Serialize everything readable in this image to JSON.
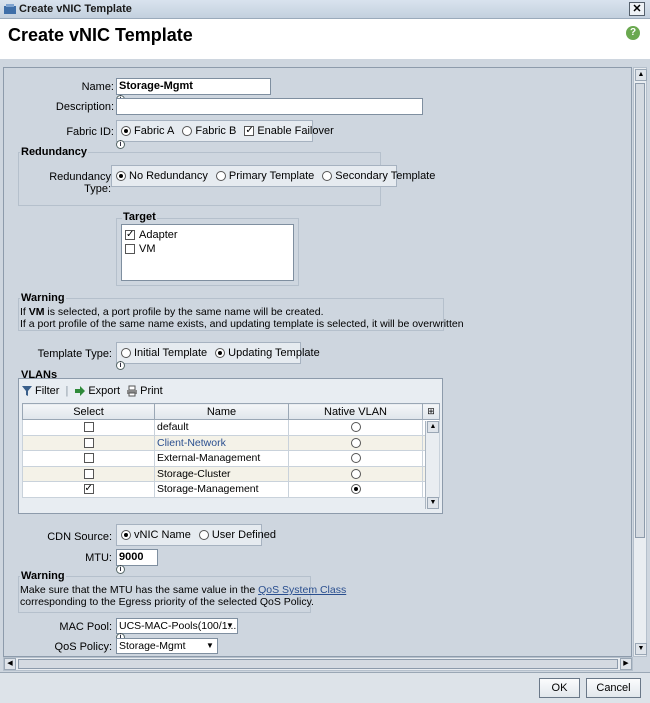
{
  "window": {
    "title": "Create vNIC Template",
    "close_glyph": "✕"
  },
  "header": {
    "title": "Create vNIC Template",
    "help_glyph": "?"
  },
  "info_glyph": "i",
  "form": {
    "name": {
      "label": "Name:",
      "value": "Storage-Mgmt"
    },
    "description": {
      "label": "Description:",
      "value": ""
    },
    "fabric_id": {
      "label": "Fabric ID:",
      "option_a": "Fabric A",
      "option_b": "Fabric B",
      "failover": "Enable Failover",
      "selected": "Fabric A",
      "failover_checked": true
    },
    "redundancy": {
      "group_title": "Redundancy",
      "label": "Redundancy Type:",
      "options": [
        "No Redundancy",
        "Primary Template",
        "Secondary Template"
      ],
      "selected": "No Redundancy"
    },
    "target": {
      "title": "Target",
      "items": [
        {
          "label": "Adapter",
          "checked": true
        },
        {
          "label": "VM",
          "checked": false
        }
      ]
    },
    "warning1": {
      "title": "Warning",
      "line1_pre": "If ",
      "line1_bold": "VM",
      "line1_post": " is selected, a port profile by the same name will be created.",
      "line2": "If a port profile of the same name exists, and updating template is selected, it will be overwritten"
    },
    "template_type": {
      "label": "Template Type:",
      "options": [
        "Initial Template",
        "Updating Template"
      ],
      "selected": "Updating Template"
    },
    "vlans": {
      "title": "VLANs",
      "toolbar": {
        "filter": "Filter",
        "export": "Export",
        "print": "Print"
      },
      "columns": [
        "Select",
        "Name",
        "Native VLAN"
      ],
      "rows": [
        {
          "name": "default",
          "selected": false,
          "native": false
        },
        {
          "name": "Client-Network",
          "selected": false,
          "native": false
        },
        {
          "name": "External-Management",
          "selected": false,
          "native": false
        },
        {
          "name": "Storage-Cluster",
          "selected": false,
          "native": false
        },
        {
          "name": "Storage-Management",
          "selected": true,
          "native": true
        }
      ]
    },
    "cdn_source": {
      "label": "CDN Source:",
      "options": [
        "vNIC Name",
        "User Defined"
      ],
      "selected": "vNIC Name"
    },
    "mtu": {
      "label": "MTU:",
      "value": "9000"
    },
    "warning2": {
      "title": "Warning",
      "pre": "Make sure that the MTU has the same value in the ",
      "link": "QoS System Class",
      "line2": "corresponding to the Egress priority of the selected QoS Policy."
    },
    "mac_pool": {
      "label": "MAC Pool:",
      "value": "UCS-MAC-Pools(100/1..."
    },
    "qos_policy": {
      "label": "QoS Policy:",
      "value": "Storage-Mgmt"
    }
  },
  "footer": {
    "ok": "OK",
    "cancel": "Cancel"
  }
}
